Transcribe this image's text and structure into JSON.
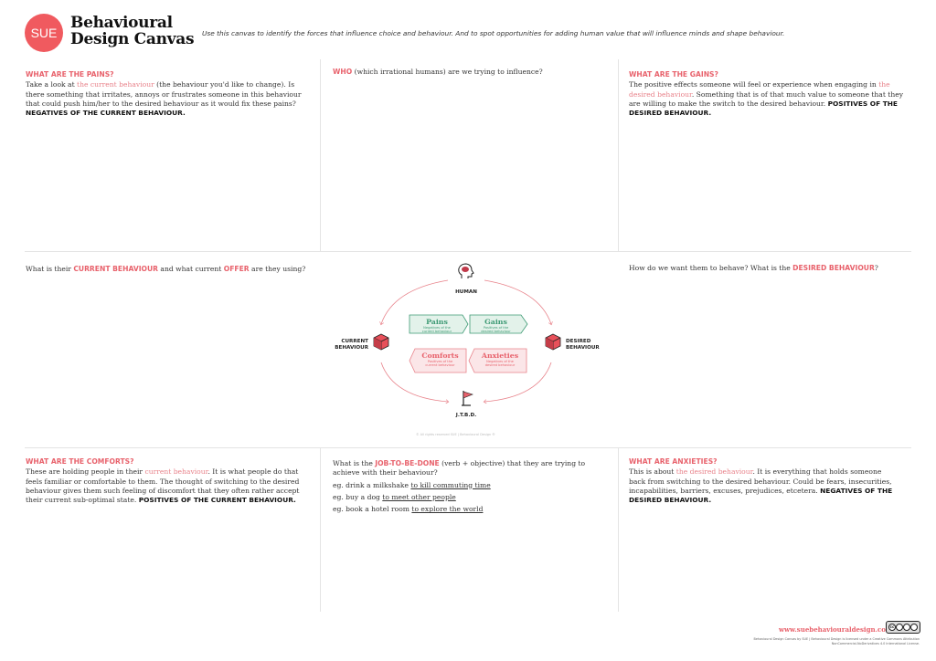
{
  "header": {
    "logo_text": "SUE",
    "title_line1": "Behavioural",
    "title_line2": "Design Canvas",
    "tagline": "Use this canvas to identify the forces that influence choice and behaviour. And to spot opportunities for adding human value that will influence minds and shape behaviour."
  },
  "pains": {
    "heading": "WHAT ARE THE PAINS?",
    "t1": "Take a look at ",
    "hl": "the current behaviour",
    "t2": " (the behaviour you'd like to change). Is there something that irritates, annoys or frustrates someone in this behaviour that could push him/her to the desired behaviour as it would fix these pains? ",
    "emphasis": "NEGATIVES OF THE CURRENT BEHAVIOUR."
  },
  "who": {
    "keyword": "WHO",
    "text": " (which irrational humans) are we trying to inﬂuence?"
  },
  "gains": {
    "heading": "WHAT ARE THE GAINS?",
    "t1": "The positive effects someone will feel or experience when engaging in ",
    "hl": "the desired behaviour",
    "t2": ". Something that is of that much value to someone that they are willing to make the switch to the desired behaviour. ",
    "emphasis": "POSITIVES OF THE DESIRED BEHAVIOUR."
  },
  "current": {
    "t1": "What is their ",
    "kw1": "CURRENT BEHAVIOUR",
    "t2": " and what current ",
    "kw2": "OFFER",
    "t3": " are they using?"
  },
  "desired": {
    "t1": "How do we want them to behave? What is the ",
    "kw": "DESIRED BEHAVIOUR",
    "t2": "?"
  },
  "diagram": {
    "human": "HUMAN",
    "current_l1": "CURRENT",
    "current_l2": "BEHAVIOUR",
    "desired_l1": "DESIRED",
    "desired_l2": "BEHAVIOUR",
    "jtbd": "J.T.B.D.",
    "cards": [
      {
        "title": "Pains",
        "sub1": "Negatives of the",
        "sub2": "current behaviour"
      },
      {
        "title": "Gains",
        "sub1": "Positives of the",
        "sub2": "desired behaviour"
      },
      {
        "title": "Comforts",
        "sub1": "Positives of the",
        "sub2": "current behaviour"
      },
      {
        "title": "Anxieties",
        "sub1": "Negatives of the",
        "sub2": "desired behaviour"
      }
    ],
    "copyright": "© All rights reserved SUE | Behavioural Design ®"
  },
  "comforts": {
    "heading": "WHAT ARE THE COMFORTS?",
    "t1": "These are holding people in their ",
    "hl": "current behaviour",
    "t2": ". It is what people do that feels familiar or comfortable to them. The thought of switching to the desired behaviour gives them such feeling of discomfort that they often rather accept their current sub-optimal state. ",
    "emphasis": "POSITIVES OF THE CURRENT BEHAVIOUR."
  },
  "jtbd": {
    "t1": "What is the ",
    "kw": "JOB-TO-BE-DONE",
    "t2": " (verb + objective) that they are trying to achieve with their behaviour?",
    "examples": [
      {
        "prefix": "eg. drink a milkshake ",
        "goal": "to kill commuting time"
      },
      {
        "prefix": "eg. buy a dog ",
        "goal": "to meet other people"
      },
      {
        "prefix": "eg. book a hotel room ",
        "goal": "to explore the world"
      }
    ]
  },
  "anxieties": {
    "heading": "WHAT ARE ANXIETIES?",
    "t1": "This is about ",
    "hl": "the desired behaviour",
    "t2": ". It is everything that holds someone back from switching to the desired behaviour. Could be fears, insecurities, incapabilities, barriers, excuses, prejudices, etcetera. ",
    "emphasis": "NEGATIVES OF THE DESIRED BEHAVIOUR."
  },
  "footer": {
    "url": "www.suebehaviouraldesign.com",
    "license_l1": "Behavioural Design Canvas by SUE | Behavioural Design is licensed under a Creative Commons Attribution",
    "license_l2": "NonCommercial-NoDerivatives 4.0 International License.",
    "cc_label": "cc"
  },
  "colors": {
    "accent": "#e8626c",
    "logo": "#f05a5f",
    "green": "#3d9a74"
  }
}
